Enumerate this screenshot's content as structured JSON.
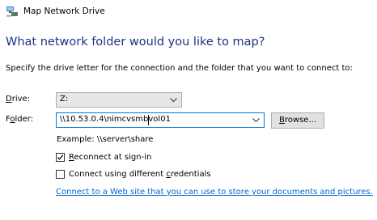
{
  "window": {
    "title": "Map Network Drive",
    "icon": "network-drive-icon"
  },
  "heading": "What network folder would you like to map?",
  "instructions": "Specify the drive letter for the connection and the folder that you want to connect to:",
  "drive": {
    "label_accel": "D",
    "label_rest": "rive:",
    "value": "Z:"
  },
  "folder": {
    "label_pre": "F",
    "label_accel": "o",
    "label_rest": "lder:",
    "value": "\\\\10.53.0.4\\nimcvsmbvol01"
  },
  "browse": {
    "label_accel": "B",
    "label_rest": "rowse..."
  },
  "example": "Example: \\\\server\\share",
  "reconnect": {
    "label_accel": "R",
    "label_rest": "econnect at sign-in",
    "checked": true
  },
  "credentials": {
    "label_pre": "Connect using different ",
    "label_accel": "c",
    "label_rest": "redentials",
    "checked": false
  },
  "web_link": "Connect to a Web site that you can use to store your documents and pictures.",
  "colors": {
    "heading": "#1e3287",
    "link": "#0066cc",
    "focus_border": "#0078d7"
  }
}
